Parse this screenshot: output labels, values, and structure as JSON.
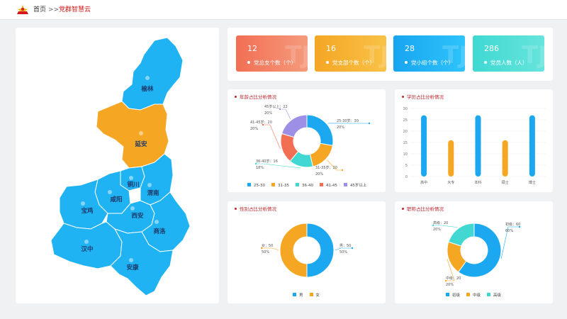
{
  "header": {
    "home": "首页",
    "separator": ">>",
    "current": "党群智慧云"
  },
  "colors": {
    "blue": "#1ba8f0",
    "orange": "#f5a623",
    "cyan": "#42d8d2",
    "coral": "#f26f54",
    "purple": "#9e8fe6",
    "accent_red": "#c0272d"
  },
  "map": {
    "regions": [
      "榆林",
      "延安",
      "铜川",
      "渭南",
      "咸阳",
      "宝鸡",
      "西安",
      "商洛",
      "汉中",
      "安康"
    ],
    "highlighted": "延安"
  },
  "stats": [
    {
      "value": "12",
      "label": "党总支个数（个）"
    },
    {
      "value": "16",
      "label": "党支部个数（个）"
    },
    {
      "value": "28",
      "label": "党小组个数（个）"
    },
    {
      "value": "286",
      "label": "党员人数（人）"
    }
  ],
  "age_chart": {
    "title": "年龄占比分析情况",
    "chart_data": {
      "type": "pie",
      "series": [
        {
          "name": "25-30",
          "label": "25-30岁：30",
          "value": 30,
          "percent": "20%",
          "color": "#1ba8f0"
        },
        {
          "name": "31-35",
          "label": "31-35岁：20",
          "value": 20,
          "percent": "20%",
          "color": "#f5a623"
        },
        {
          "name": "36-40",
          "label": "36-40岁：16",
          "value": 16,
          "percent": "18%",
          "color": "#42d8d2"
        },
        {
          "name": "41-45",
          "label": "41-45岁：20",
          "value": 20,
          "percent": "20%",
          "color": "#f26f54"
        },
        {
          "name": "45岁以上",
          "label": "45岁以上：22",
          "value": 22,
          "percent": "20%",
          "color": "#9e8fe6"
        }
      ]
    }
  },
  "edu_chart": {
    "title": "学历占比分析情况",
    "chart_data": {
      "type": "bar",
      "categories": [
        "高中",
        "大专",
        "本科",
        "硕士",
        "博士"
      ],
      "values": [
        27,
        16,
        27,
        16,
        27
      ],
      "ylim": [
        0,
        30
      ],
      "yticks": [
        "0",
        "5",
        "10",
        "15",
        "20",
        "25",
        "30"
      ],
      "colors": [
        "#1ba8f0",
        "#f5a623",
        "#1ba8f0",
        "#f5a623",
        "#1ba8f0"
      ],
      "grid": true
    }
  },
  "sex_chart": {
    "title": "性别占比分析情况",
    "chart_data": {
      "type": "pie",
      "series": [
        {
          "name": "男",
          "label": "男：50",
          "value": 50,
          "percent": "50%",
          "color": "#1ba8f0"
        },
        {
          "name": "女",
          "label": "女：50",
          "value": 50,
          "percent": "50%",
          "color": "#f5a623"
        }
      ]
    }
  },
  "title_chart": {
    "title": "职称占比分析情况",
    "chart_data": {
      "type": "pie",
      "series": [
        {
          "name": "初级",
          "label": "初级：60",
          "value": 60,
          "percent": "60%",
          "color": "#1ba8f0"
        },
        {
          "name": "中级",
          "label": "中级：20",
          "value": 20,
          "percent": "20%",
          "color": "#f5a623"
        },
        {
          "name": "高级",
          "label": "高级：20",
          "value": 20,
          "percent": "20%",
          "color": "#42d8d2"
        }
      ]
    }
  }
}
